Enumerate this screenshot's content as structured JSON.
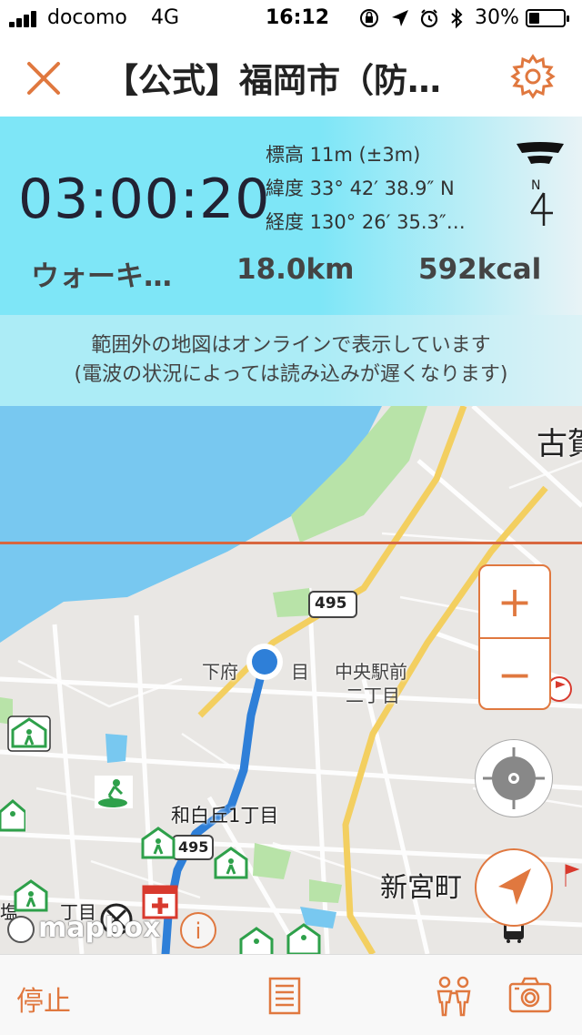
{
  "status_bar": {
    "carrier": "docomo",
    "network": "4G",
    "time": "16:12",
    "battery": "30%",
    "battery_level": 0.3
  },
  "nav": {
    "title": "【公式】福岡市（防…",
    "close_icon": "close-icon",
    "settings_icon": "gear-icon"
  },
  "info": {
    "timer": "03:00:20",
    "altitude": "標高 11m (±3m)",
    "latitude": "緯度 33° 42′ 38.9″ N",
    "longitude": "経度 130° 26′ 35.3″…",
    "activity": "ウォーキ…",
    "distance": "18.0km",
    "calories": "592kcal",
    "compass_label": "N",
    "notice_line1": "範囲外の地図はオンラインで表示しています",
    "notice_line2": "(電波の状況によっては読み込みが遅くなります)"
  },
  "map": {
    "label_koga": "古賀",
    "route_shield": "495",
    "label_shimofu_a": "下府",
    "label_shimofu_b": "目",
    "label_chuo_1": "中央駅前",
    "label_chuo_2": "二丁目",
    "label_wajiro": "和白丘1丁目",
    "label_shingu": "新宮町",
    "label_shield2": "495",
    "label_chome": "丁目",
    "label_shio": "塩",
    "mapbox": "mapbox",
    "info_btn": "i",
    "zoom_in": "+",
    "zoom_out": "−"
  },
  "tab_bar": {
    "stop": "停止",
    "list_icon": "list-icon",
    "people_icon": "people-icon",
    "camera_icon": "camera-icon"
  },
  "colors": {
    "accent": "#e0783f",
    "panel": "#7ee6f7",
    "route": "#2e7fd8",
    "water": "#78c8f0",
    "park": "#b8e3a8",
    "road": "#f3cf60"
  }
}
